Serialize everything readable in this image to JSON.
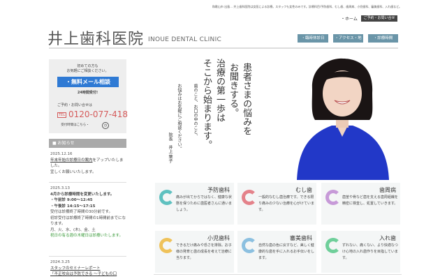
{
  "header": {
    "tagline": "和歌山市 出島… 井上歯科医院は女医による診療。スタッフも女性のみです。診療科目/予防歯科、むし歯、歯周病、小児歯科、審美歯科、入れ歯など。",
    "home_link": "・ホーム",
    "contact_link": "ご予約・お問い合せ",
    "logo": "井上歯科医院",
    "logo_en": "INOUE DENTAL CLINIC",
    "nav": [
      "・臨時休診日",
      "・アクセス・地図",
      "・診療時間"
    ],
    "nav_color": "#6a95a8"
  },
  "sidebar": {
    "intro1": "初めての方も",
    "intro2": "お気軽にご相談ください。",
    "mail_button": "・無料メール相談",
    "mail_note": "24時間受付!",
    "tel_label": "ご予約・お問い合せは",
    "tel_badge": "TEL",
    "tel": "0120-077-418",
    "hours_link": "受付時間はこちら・",
    "notice_title": "■ お知らせ",
    "news": [
      {
        "date": "2025.12.16",
        "link": "年末年始の診療日の案内",
        "text": "をアップいたしました。",
        "text2": "宜しくお願いいたします。"
      },
      {
        "date": "2025.3.13",
        "title": "4月から診療時間を変更いたします。",
        "am": "・午前診 9:00〜12:45",
        "pm": "・午後診 14:15〜17:15",
        "l1": "受付は診療終了時間の30分前です。",
        "l2": "初診受付は診療終了時間の1時間前までになります。",
        "days": "月、火、水、(木)、金、土",
        "green": "祝日の有る週の木曜日は診療いたします。"
      },
      {
        "date": "2024.3.25",
        "link": "スタッフのセミナーレポート",
        "link2": "「不正咬合は予防できる 〜子どもの口"
      }
    ]
  },
  "message": {
    "lines": [
      "患者さまの悩みを",
      "お聞きする。",
      "治療の第一歩は",
      "そこから始まります。"
    ],
    "sub": [
      "歯のこと、お口の中のこと、",
      "お悩みはお気軽にご相談ください。"
    ],
    "signature": "院長　井上 葉子"
  },
  "services": [
    {
      "title": "予防歯科",
      "desc": "痛みが出てからではなく、健康な状態を保つために歯医者さんに通いましょう。",
      "color": "#5fc1c0"
    },
    {
      "title": "むし歯",
      "desc": "一般的なむし歯治療です。できる限り痛みの少ない治療を心がけています。",
      "color": "#e4828a"
    },
    {
      "title": "歯周病",
      "desc": "歯茎や骨など歯を支える歯周組織を精密に検査し、処置していきます。",
      "color": "#c79ad8"
    },
    {
      "title": "小児歯科",
      "desc": "できるだけ痛みや恐さを排除。お子様の発育と歯の成長を考えて治療に当ります。",
      "color": "#efc25a"
    },
    {
      "title": "審美歯科",
      "desc": "自然な歯の色に戻すなど、美しく健康的な歯を手に入れるお手伝いをします。",
      "color": "#8cc0e0"
    },
    {
      "title": "入れ歯",
      "desc": "ずれない、痛くない、より快適なつけ心地の入れ歯作りを目指しています。",
      "color": "#6fcf9a"
    }
  ]
}
